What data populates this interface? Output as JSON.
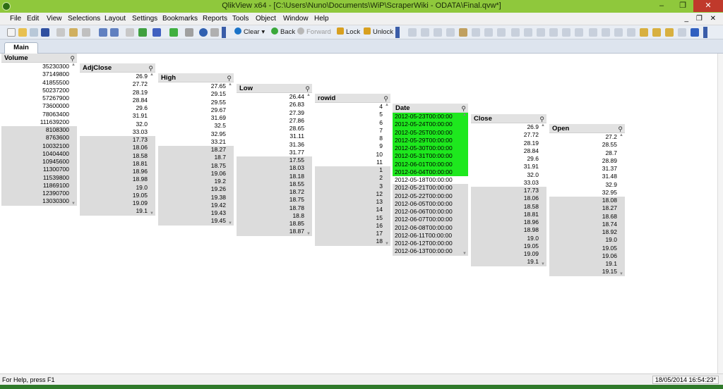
{
  "window": {
    "title": "QlikView x64 - [C:\\Users\\Nuno\\Documents\\WiP\\ScraperWiki - ODATA\\Final.qvw*]",
    "minimize_glyph": "–",
    "maximize_glyph": "❐",
    "close_glyph": "✕"
  },
  "menu": {
    "items": [
      "File",
      "Edit",
      "View",
      "Selections",
      "Layout",
      "Settings",
      "Bookmarks",
      "Reports",
      "Tools",
      "Object",
      "Window",
      "Help"
    ],
    "doc_controls": "_ ❐ ✕"
  },
  "toolbar": {
    "clear": "Clear",
    "back": "Back",
    "forward": "Forward",
    "lock": "Lock",
    "unlock": "Unlock",
    "colors": {
      "clear": "#1a73c8",
      "back": "#3aa83a",
      "forward": "#b8b8b8",
      "lock": "#d8a020",
      "unlock": "#d8a020"
    }
  },
  "tabs": {
    "main": "Main"
  },
  "listboxes": [
    {
      "title": "Volume",
      "rows": [
        {
          "v": "35230300",
          "s": "possible"
        },
        {
          "v": "37149800",
          "s": "possible"
        },
        {
          "v": "41855500",
          "s": "possible"
        },
        {
          "v": "50237200",
          "s": "possible"
        },
        {
          "v": "57267900",
          "s": "possible"
        },
        {
          "v": "73600000",
          "s": "possible"
        },
        {
          "v": "78063400",
          "s": "possible"
        },
        {
          "v": "111639200",
          "s": "possible"
        },
        {
          "v": "8108300",
          "s": "excluded"
        },
        {
          "v": "8763600",
          "s": "excluded"
        },
        {
          "v": "10032100",
          "s": "excluded"
        },
        {
          "v": "10404400",
          "s": "excluded"
        },
        {
          "v": "10945600",
          "s": "excluded"
        },
        {
          "v": "11300700",
          "s": "excluded"
        },
        {
          "v": "11539800",
          "s": "excluded"
        },
        {
          "v": "11869100",
          "s": "excluded"
        },
        {
          "v": "12390700",
          "s": "excluded"
        },
        {
          "v": "13030300",
          "s": "excluded"
        }
      ]
    },
    {
      "title": "AdjClose",
      "rows": [
        {
          "v": "26.9",
          "s": "possible"
        },
        {
          "v": "27.72",
          "s": "possible"
        },
        {
          "v": "28.19",
          "s": "possible"
        },
        {
          "v": "28.84",
          "s": "possible"
        },
        {
          "v": "29.6",
          "s": "possible"
        },
        {
          "v": "31.91",
          "s": "possible"
        },
        {
          "v": "32.0",
          "s": "possible"
        },
        {
          "v": "33.03",
          "s": "possible"
        },
        {
          "v": "17.73",
          "s": "excluded"
        },
        {
          "v": "18.06",
          "s": "excluded"
        },
        {
          "v": "18.58",
          "s": "excluded"
        },
        {
          "v": "18.81",
          "s": "excluded"
        },
        {
          "v": "18.96",
          "s": "excluded"
        },
        {
          "v": "18.98",
          "s": "excluded"
        },
        {
          "v": "19.0",
          "s": "excluded"
        },
        {
          "v": "19.05",
          "s": "excluded"
        },
        {
          "v": "19.09",
          "s": "excluded"
        },
        {
          "v": "19.1",
          "s": "excluded"
        }
      ]
    },
    {
      "title": "High",
      "rows": [
        {
          "v": "27.65",
          "s": "possible"
        },
        {
          "v": "29.15",
          "s": "possible"
        },
        {
          "v": "29.55",
          "s": "possible"
        },
        {
          "v": "29.67",
          "s": "possible"
        },
        {
          "v": "31.69",
          "s": "possible"
        },
        {
          "v": "32.5",
          "s": "possible"
        },
        {
          "v": "32.95",
          "s": "possible"
        },
        {
          "v": "33.21",
          "s": "possible"
        },
        {
          "v": "18.27",
          "s": "excluded"
        },
        {
          "v": "18.7",
          "s": "excluded"
        },
        {
          "v": "18.75",
          "s": "excluded"
        },
        {
          "v": "19.06",
          "s": "excluded"
        },
        {
          "v": "19.2",
          "s": "excluded"
        },
        {
          "v": "19.26",
          "s": "excluded"
        },
        {
          "v": "19.38",
          "s": "excluded"
        },
        {
          "v": "19.42",
          "s": "excluded"
        },
        {
          "v": "19.43",
          "s": "excluded"
        },
        {
          "v": "19.45",
          "s": "excluded"
        }
      ]
    },
    {
      "title": "Low",
      "rows": [
        {
          "v": "26.44",
          "s": "possible"
        },
        {
          "v": "26.83",
          "s": "possible"
        },
        {
          "v": "27.39",
          "s": "possible"
        },
        {
          "v": "27.86",
          "s": "possible"
        },
        {
          "v": "28.65",
          "s": "possible"
        },
        {
          "v": "31.11",
          "s": "possible"
        },
        {
          "v": "31.36",
          "s": "possible"
        },
        {
          "v": "31.77",
          "s": "possible"
        },
        {
          "v": "17.55",
          "s": "excluded"
        },
        {
          "v": "18.03",
          "s": "excluded"
        },
        {
          "v": "18.18",
          "s": "excluded"
        },
        {
          "v": "18.55",
          "s": "excluded"
        },
        {
          "v": "18.72",
          "s": "excluded"
        },
        {
          "v": "18.75",
          "s": "excluded"
        },
        {
          "v": "18.78",
          "s": "excluded"
        },
        {
          "v": "18.8",
          "s": "excluded"
        },
        {
          "v": "18.85",
          "s": "excluded"
        },
        {
          "v": "18.87",
          "s": "excluded"
        }
      ]
    },
    {
      "title": "rowid",
      "rows": [
        {
          "v": "4",
          "s": "possible"
        },
        {
          "v": "5",
          "s": "possible"
        },
        {
          "v": "6",
          "s": "possible"
        },
        {
          "v": "7",
          "s": "possible"
        },
        {
          "v": "8",
          "s": "possible"
        },
        {
          "v": "9",
          "s": "possible"
        },
        {
          "v": "10",
          "s": "possible"
        },
        {
          "v": "11",
          "s": "possible"
        },
        {
          "v": "1",
          "s": "excluded"
        },
        {
          "v": "2",
          "s": "excluded"
        },
        {
          "v": "3",
          "s": "excluded"
        },
        {
          "v": "12",
          "s": "excluded"
        },
        {
          "v": "13",
          "s": "excluded"
        },
        {
          "v": "14",
          "s": "excluded"
        },
        {
          "v": "15",
          "s": "excluded"
        },
        {
          "v": "16",
          "s": "excluded"
        },
        {
          "v": "17",
          "s": "excluded"
        },
        {
          "v": "18",
          "s": "excluded"
        }
      ]
    },
    {
      "title": "Date",
      "rows": [
        {
          "v": "2012-05-23T00:00:00",
          "s": "selected"
        },
        {
          "v": "2012-05-24T00:00:00",
          "s": "selected"
        },
        {
          "v": "2012-05-25T00:00:00",
          "s": "selected"
        },
        {
          "v": "2012-05-29T00:00:00",
          "s": "selected"
        },
        {
          "v": "2012-05-30T00:00:00",
          "s": "selected"
        },
        {
          "v": "2012-05-31T00:00:00",
          "s": "selected"
        },
        {
          "v": "2012-06-01T00:00:00",
          "s": "selected"
        },
        {
          "v": "2012-06-04T00:00:00",
          "s": "selected"
        },
        {
          "v": "2012-05-18T00:00:00",
          "s": "alt"
        },
        {
          "v": "2012-05-21T00:00:00",
          "s": "altex"
        },
        {
          "v": "2012-05-22T00:00:00",
          "s": "altex"
        },
        {
          "v": "2012-06-05T00:00:00",
          "s": "altex"
        },
        {
          "v": "2012-06-06T00:00:00",
          "s": "altex"
        },
        {
          "v": "2012-06-07T00:00:00",
          "s": "altex"
        },
        {
          "v": "2012-06-08T00:00:00",
          "s": "altex"
        },
        {
          "v": "2012-06-11T00:00:00",
          "s": "altex"
        },
        {
          "v": "2012-06-12T00:00:00",
          "s": "altex"
        },
        {
          "v": "2012-06-13T00:00:00",
          "s": "altex"
        }
      ]
    },
    {
      "title": "Close",
      "rows": [
        {
          "v": "26.9",
          "s": "possible"
        },
        {
          "v": "27.72",
          "s": "possible"
        },
        {
          "v": "28.19",
          "s": "possible"
        },
        {
          "v": "28.84",
          "s": "possible"
        },
        {
          "v": "29.6",
          "s": "possible"
        },
        {
          "v": "31.91",
          "s": "possible"
        },
        {
          "v": "32.0",
          "s": "possible"
        },
        {
          "v": "33.03",
          "s": "possible"
        },
        {
          "v": "17.73",
          "s": "excluded"
        },
        {
          "v": "18.06",
          "s": "excluded"
        },
        {
          "v": "18.58",
          "s": "excluded"
        },
        {
          "v": "18.81",
          "s": "excluded"
        },
        {
          "v": "18.96",
          "s": "excluded"
        },
        {
          "v": "18.98",
          "s": "excluded"
        },
        {
          "v": "19.0",
          "s": "excluded"
        },
        {
          "v": "19.05",
          "s": "excluded"
        },
        {
          "v": "19.09",
          "s": "excluded"
        },
        {
          "v": "19.1",
          "s": "excluded"
        }
      ]
    },
    {
      "title": "Open",
      "rows": [
        {
          "v": "27.2",
          "s": "possible"
        },
        {
          "v": "28.55",
          "s": "possible"
        },
        {
          "v": "28.7",
          "s": "possible"
        },
        {
          "v": "28.89",
          "s": "possible"
        },
        {
          "v": "31.37",
          "s": "possible"
        },
        {
          "v": "31.48",
          "s": "possible"
        },
        {
          "v": "32.9",
          "s": "possible"
        },
        {
          "v": "32.95",
          "s": "possible"
        },
        {
          "v": "18.08",
          "s": "excluded"
        },
        {
          "v": "18.27",
          "s": "excluded"
        },
        {
          "v": "18.68",
          "s": "excluded"
        },
        {
          "v": "18.74",
          "s": "excluded"
        },
        {
          "v": "18.92",
          "s": "excluded"
        },
        {
          "v": "19.0",
          "s": "excluded"
        },
        {
          "v": "19.05",
          "s": "excluded"
        },
        {
          "v": "19.06",
          "s": "excluded"
        },
        {
          "v": "19.1",
          "s": "excluded"
        },
        {
          "v": "19.15",
          "s": "excluded"
        }
      ]
    }
  ],
  "listbox_search_glyph": "⚲",
  "status": {
    "help": "For Help, press F1",
    "timestamp": "18/05/2014 16:54:23*"
  }
}
